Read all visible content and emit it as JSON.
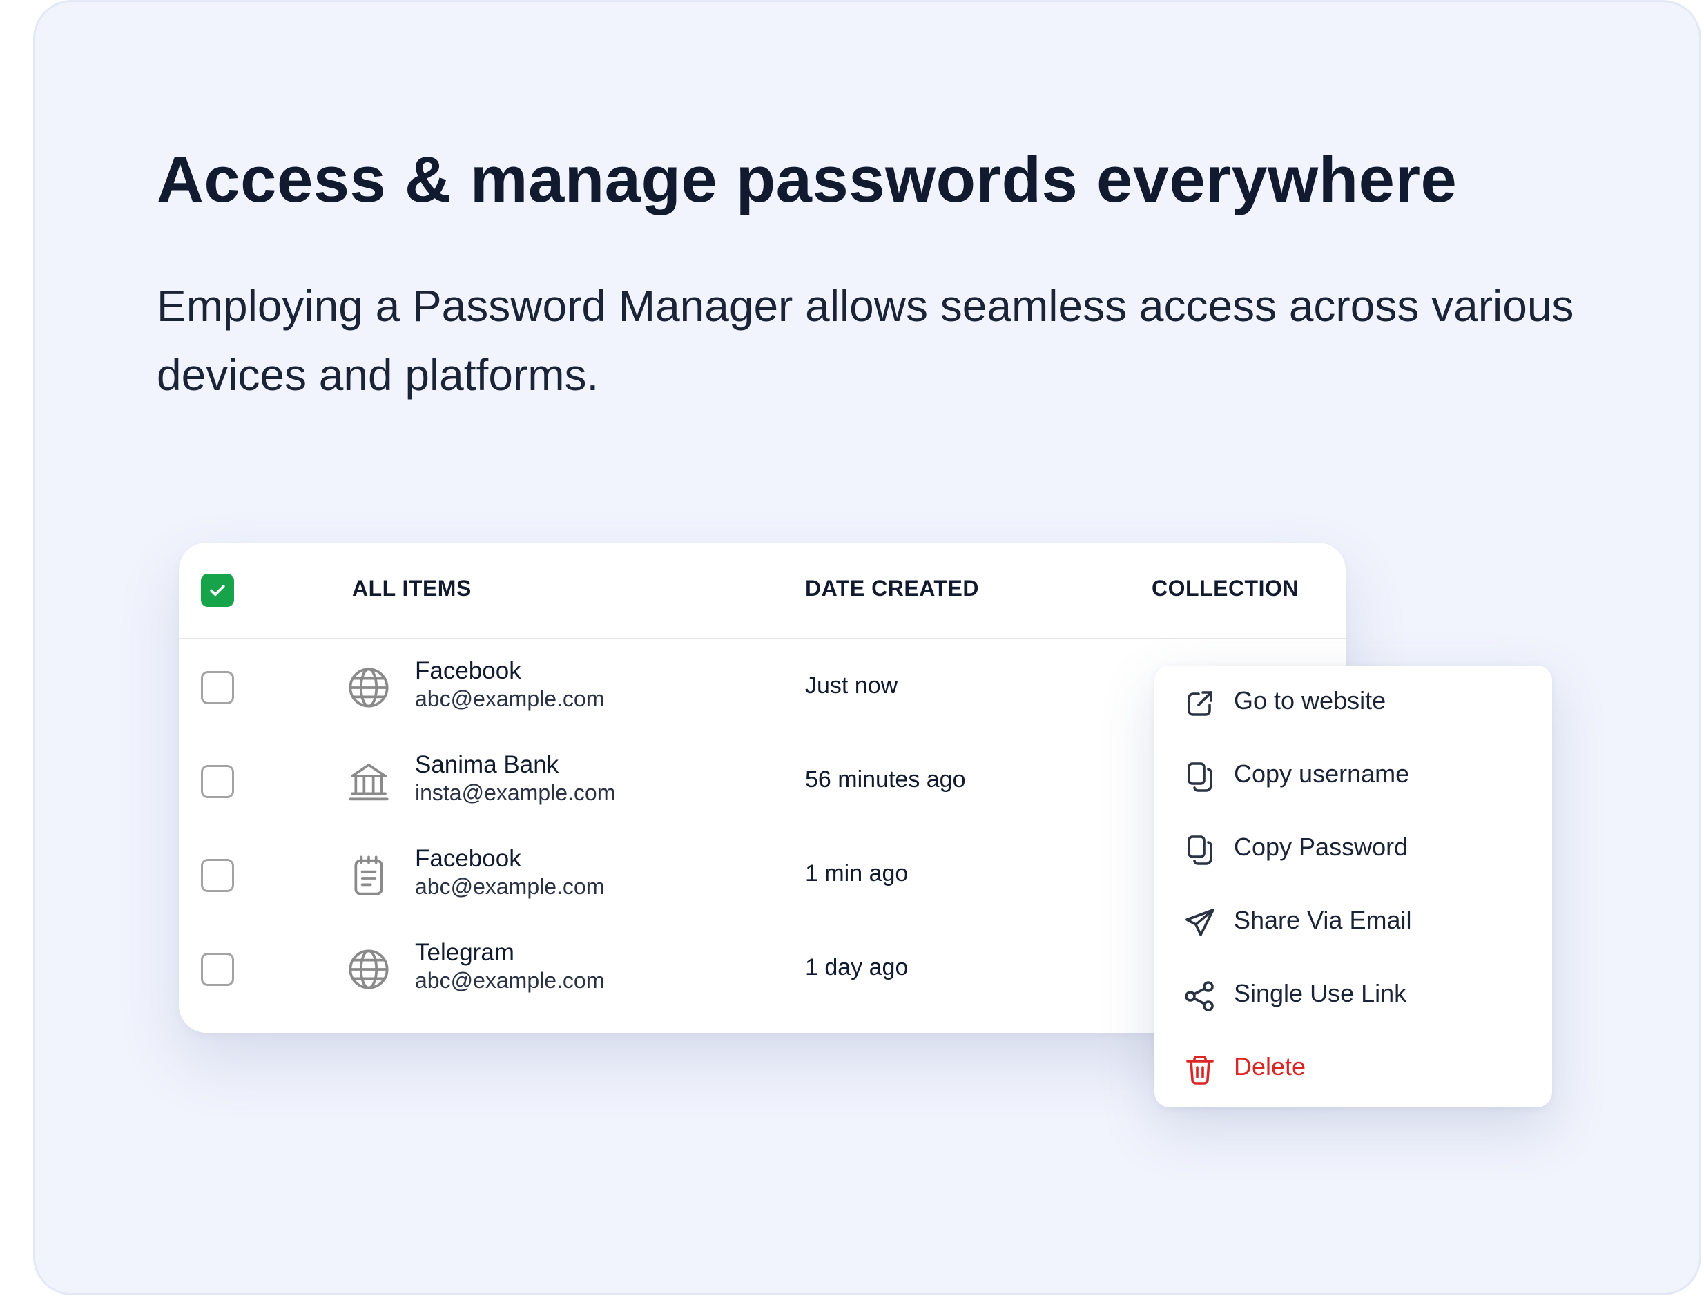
{
  "hero": {
    "title": "Access & manage passwords everywhere",
    "subtitle": "Employing a Password Manager allows seamless access across various devices and platforms."
  },
  "table": {
    "select_all_checked": true,
    "columns": [
      "ALL ITEMS",
      "DATE CREATED",
      "COLLECTION"
    ],
    "rows": [
      {
        "icon": "globe-icon",
        "name": "Facebook",
        "email": "abc@example.com",
        "date": "Just now",
        "checked": false
      },
      {
        "icon": "bank-icon",
        "name": "Sanima Bank",
        "email": "insta@example.com",
        "date": "56 minutes ago",
        "checked": false
      },
      {
        "icon": "notepad-icon",
        "name": "Facebook",
        "email": "abc@example.com",
        "date": "1 min ago",
        "checked": false
      },
      {
        "icon": "globe-icon",
        "name": "Telegram",
        "email": "abc@example.com",
        "date": "1 day ago",
        "checked": false
      }
    ]
  },
  "context_menu": {
    "items": [
      {
        "icon": "external-link-icon",
        "label": "Go to website"
      },
      {
        "icon": "copy-icon",
        "label": "Copy username"
      },
      {
        "icon": "copy-icon",
        "label": "Copy Password"
      },
      {
        "icon": "send-icon",
        "label": "Share Via Email"
      },
      {
        "icon": "share-icon",
        "label": "Single Use Link"
      },
      {
        "icon": "trash-icon",
        "label": "Delete",
        "danger": true
      }
    ]
  },
  "colors": {
    "background": "#f1f4fd",
    "checkbox_checked": "#16a34a",
    "danger": "#dc2626",
    "text_primary": "#111a2e",
    "icon_gray": "#8a8a8a"
  }
}
